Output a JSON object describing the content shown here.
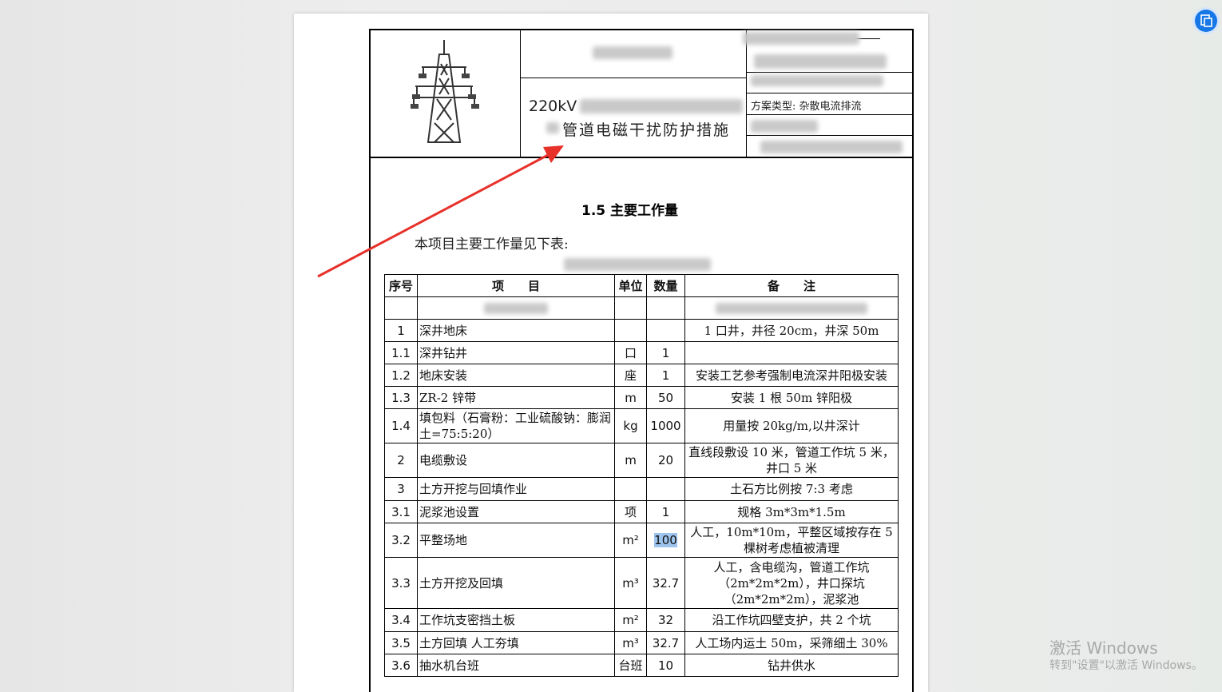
{
  "header": {
    "title_line1": "220kV",
    "title_line2": "管道电磁干扰防护措施",
    "scheme_type": "方案类型: 杂散电流排流"
  },
  "section": {
    "heading": "1.5  主要工作量",
    "intro": "本项目主要工作量见下表:"
  },
  "table": {
    "headers": [
      "序号",
      "项　　目",
      "单位",
      "数量",
      "备　　注"
    ],
    "rows": [
      {
        "no": "1",
        "item": "深井地床",
        "unit": "",
        "qty": "",
        "remark": "1 口井，井径 20cm，井深 50m"
      },
      {
        "no": "1.1",
        "item": "深井钻井",
        "unit": "口",
        "qty": "1",
        "remark": ""
      },
      {
        "no": "1.2",
        "item": "地床安装",
        "unit": "座",
        "qty": "1",
        "remark": "安装工艺参考强制电流深井阳极安装"
      },
      {
        "no": "1.3",
        "item": "ZR-2 锌带",
        "unit": "m",
        "qty": "50",
        "remark": "安装 1 根 50m 锌阳极"
      },
      {
        "no": "1.4",
        "item": "填包料（石膏粉：工业硫酸钠：膨润土=75:5:20）",
        "unit": "kg",
        "qty": "1000",
        "remark": "用量按 20kg/m,以井深计"
      },
      {
        "no": "2",
        "item": "电缆敷设",
        "unit": "m",
        "qty": "20",
        "remark": "直线段敷设 10 米，管道工作坑 5 米，井口 5 米"
      },
      {
        "no": "3",
        "item": "土方开挖与回填作业",
        "unit": "",
        "qty": "",
        "remark": "土石方比例按 7:3 考虑"
      },
      {
        "no": "3.1",
        "item": "泥浆池设置",
        "unit": "项",
        "qty": "1",
        "remark": "规格 3m*3m*1.5m"
      },
      {
        "no": "3.2",
        "item": "平整场地",
        "unit": "m²",
        "qty": "100",
        "remark": "人工，10m*10m，平整区域按存在 5 棵树考虑植被清理"
      },
      {
        "no": "3.3",
        "item": "土方开挖及回填",
        "unit": "m³",
        "qty": "32.7",
        "remark": "人工，含电缆沟，管道工作坑（2m*2m*2m），井口探坑（2m*2m*2m），泥浆池"
      },
      {
        "no": "3.4",
        "item": "工作坑支密挡土板",
        "unit": "m²",
        "qty": "32",
        "remark": "沿工作坑四壁支护，共 2 个坑"
      },
      {
        "no": "3.5",
        "item": "土方回填 人工夯填",
        "unit": "m³",
        "qty": "32.7",
        "remark": "人工场内运土 50m，采筛细土 30%"
      },
      {
        "no": "3.6",
        "item": "抽水机台班",
        "unit": "台班",
        "qty": "10",
        "remark": "钻井供水"
      }
    ]
  },
  "watermark": {
    "line1": "激活 Windows",
    "line2": "转到\"设置\"以激活 Windows。"
  },
  "colors": {
    "arrow": "#e8302a",
    "accent": "#1677e6"
  },
  "icons": [
    "power-tower-icon",
    "float-tool-icon"
  ]
}
